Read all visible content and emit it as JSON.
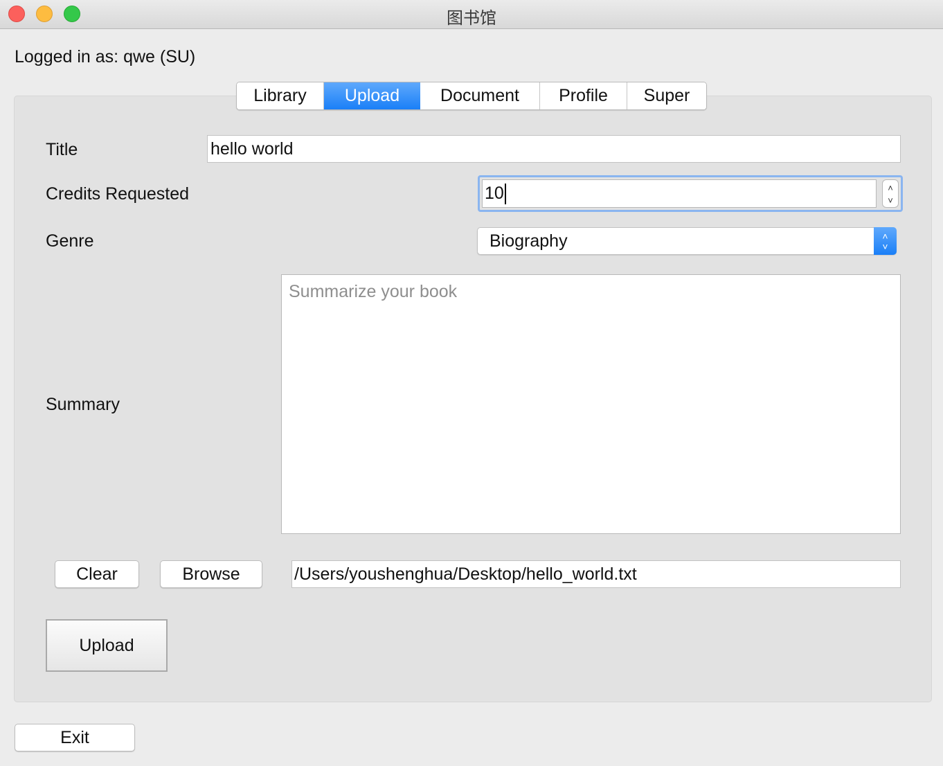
{
  "window": {
    "title": "图书馆"
  },
  "session": {
    "logged_in_text": "Logged in as: qwe (SU)"
  },
  "tabs": [
    {
      "label": "Library",
      "active": false
    },
    {
      "label": "Upload",
      "active": true
    },
    {
      "label": "Document",
      "active": false
    },
    {
      "label": "Profile",
      "active": false
    },
    {
      "label": "Super",
      "active": false
    }
  ],
  "form": {
    "title_label": "Title",
    "title_value": "hello world",
    "credits_label": "Credits Requested",
    "credits_value": "10",
    "genre_label": "Genre",
    "genre_value": "Biography",
    "summary_label": "Summary",
    "summary_placeholder": "Summarize your book",
    "summary_value": "",
    "file_path": "/Users/youshenghua/Desktop/hello_world.txt"
  },
  "buttons": {
    "clear": "Clear",
    "browse": "Browse",
    "upload": "Upload",
    "exit": "Exit"
  },
  "colors": {
    "accent": "#1a7ff7",
    "focus_ring": "#8ab5f0",
    "window_bg": "#ececec",
    "panel_bg": "#e2e2e2"
  }
}
